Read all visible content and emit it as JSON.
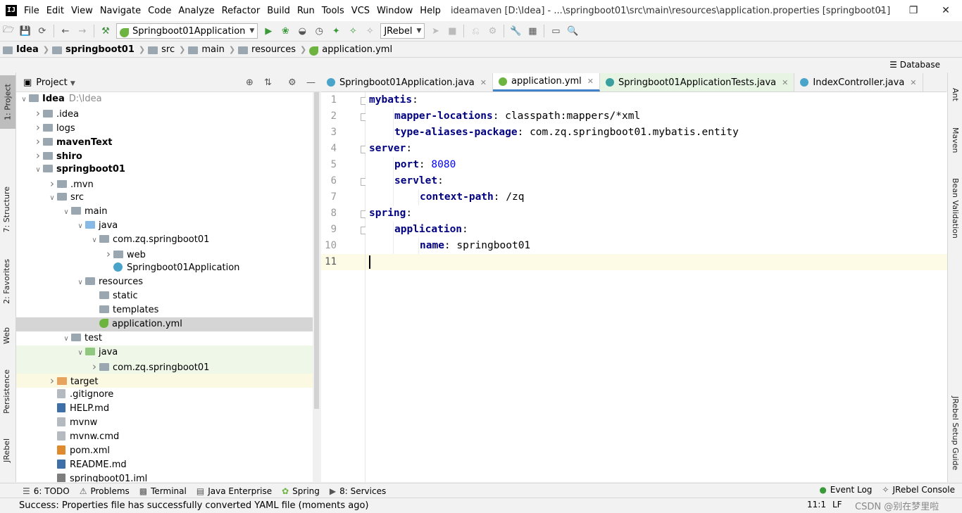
{
  "titlebar": {
    "menu": [
      "File",
      "Edit",
      "View",
      "Navigate",
      "Code",
      "Analyze",
      "Refactor",
      "Build",
      "Run",
      "Tools",
      "VCS",
      "Window",
      "Help"
    ],
    "window_title": "ideamaven [D:\\Idea] - ...\\springboot01\\src\\main\\resources\\application.properties [springboot01]"
  },
  "toolbar": {
    "run_config": "Springboot01Application",
    "jrebel": "JRebel"
  },
  "breadcrumb": [
    "Idea",
    "springboot01",
    "src",
    "main",
    "resources",
    "application.yml"
  ],
  "database_label": "Database",
  "left_tabs": [
    "1: Project",
    "7: Structure",
    "2: Favorites",
    "Web",
    "Persistence",
    "JRebel"
  ],
  "right_tabs": [
    "Ant",
    "Maven",
    "Bean Validation",
    "JRebel Setup Guide"
  ],
  "project": {
    "header": "Project",
    "tree": [
      {
        "label": "Idea",
        "hint": "D:\\Idea",
        "depth": 0,
        "exp": "open",
        "icon": "folder",
        "bold": true
      },
      {
        "label": ".idea",
        "depth": 1,
        "exp": "closed",
        "icon": "folder"
      },
      {
        "label": "logs",
        "depth": 1,
        "exp": "closed",
        "icon": "folder"
      },
      {
        "label": "mavenText",
        "depth": 1,
        "exp": "closed",
        "icon": "folder",
        "bold": true
      },
      {
        "label": "shiro",
        "depth": 1,
        "exp": "closed",
        "icon": "folder",
        "bold": true
      },
      {
        "label": "springboot01",
        "depth": 1,
        "exp": "open",
        "icon": "folder",
        "bold": true
      },
      {
        "label": ".mvn",
        "depth": 2,
        "exp": "closed",
        "icon": "folder"
      },
      {
        "label": "src",
        "depth": 2,
        "exp": "open",
        "icon": "folder"
      },
      {
        "label": "main",
        "depth": 3,
        "exp": "open",
        "icon": "folder"
      },
      {
        "label": "java",
        "depth": 4,
        "exp": "open",
        "icon": "folder-blue"
      },
      {
        "label": "com.zq.springboot01",
        "depth": 5,
        "exp": "open",
        "icon": "folder"
      },
      {
        "label": "web",
        "depth": 6,
        "exp": "closed",
        "icon": "folder"
      },
      {
        "label": "Springboot01Application",
        "depth": 6,
        "exp": "none",
        "icon": "class"
      },
      {
        "label": "resources",
        "depth": 4,
        "exp": "open",
        "icon": "folder"
      },
      {
        "label": "static",
        "depth": 5,
        "exp": "none",
        "icon": "folder"
      },
      {
        "label": "templates",
        "depth": 5,
        "exp": "none",
        "icon": "folder"
      },
      {
        "label": "application.yml",
        "depth": 5,
        "exp": "none",
        "icon": "leaf",
        "selected": true
      },
      {
        "label": "test",
        "depth": 3,
        "exp": "open",
        "icon": "folder"
      },
      {
        "label": "java",
        "depth": 4,
        "exp": "open",
        "icon": "folder-green",
        "bg": "green"
      },
      {
        "label": "com.zq.springboot01",
        "depth": 5,
        "exp": "closed",
        "icon": "folder",
        "bg": "green"
      },
      {
        "label": "target",
        "depth": 2,
        "exp": "closed",
        "icon": "folder-orange",
        "bg": "yellow"
      },
      {
        "label": ".gitignore",
        "depth": 2,
        "exp": "none",
        "icon": "file"
      },
      {
        "label": "HELP.md",
        "depth": 2,
        "exp": "none",
        "icon": "file-md"
      },
      {
        "label": "mvnw",
        "depth": 2,
        "exp": "none",
        "icon": "file"
      },
      {
        "label": "mvnw.cmd",
        "depth": 2,
        "exp": "none",
        "icon": "file"
      },
      {
        "label": "pom.xml",
        "depth": 2,
        "exp": "none",
        "icon": "file-xml"
      },
      {
        "label": "README.md",
        "depth": 2,
        "exp": "none",
        "icon": "file-md"
      },
      {
        "label": "springboot01.iml",
        "depth": 2,
        "exp": "none",
        "icon": "file-iml"
      }
    ]
  },
  "tabs": [
    {
      "label": "Springboot01Application.java",
      "icon": "class",
      "active": false
    },
    {
      "label": "application.yml",
      "icon": "leaf",
      "active": true
    },
    {
      "label": "Springboot01ApplicationTests.java",
      "icon": "test",
      "active": false,
      "test": true
    },
    {
      "label": "IndexController.java",
      "icon": "class",
      "active": false
    }
  ],
  "editor": {
    "current_line": 11,
    "lines": [
      {
        "indent": 0,
        "key": "mybatis",
        "value": ""
      },
      {
        "indent": 1,
        "key": "mapper-locations",
        "value": "classpath:mappers/*xml"
      },
      {
        "indent": 1,
        "key": "type-aliases-package",
        "value": "com.zq.springboot01.mybatis.entity"
      },
      {
        "indent": 0,
        "key": "server",
        "value": ""
      },
      {
        "indent": 1,
        "key": "port",
        "value": "8080",
        "num": true
      },
      {
        "indent": 1,
        "key": "servlet",
        "value": ""
      },
      {
        "indent": 2,
        "key": "context-path",
        "value": "/zq"
      },
      {
        "indent": 0,
        "key": "spring",
        "value": ""
      },
      {
        "indent": 1,
        "key": "application",
        "value": ""
      },
      {
        "indent": 2,
        "key": "name",
        "value": "springboot01"
      },
      {
        "indent": 0,
        "key": "",
        "value": ""
      }
    ]
  },
  "bottom_tabs": [
    "6: TODO",
    "Problems",
    "Terminal",
    "Java Enterprise",
    "Spring",
    "8: Services"
  ],
  "bottom_right": [
    "Event Log",
    "JRebel Console"
  ],
  "status": {
    "message": "Success: Properties file has successfully converted YAML file (moments ago)",
    "position": "11:1",
    "line_ending": "LF",
    "watermark": "CSDN @别在梦里啦"
  }
}
